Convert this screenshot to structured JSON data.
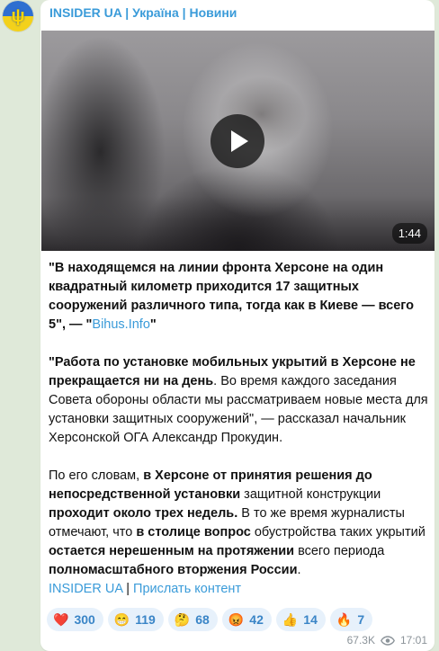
{
  "channel": {
    "name": "INSIDER UA | Україна | Новини",
    "avatar_icon": "trident-icon"
  },
  "video": {
    "duration": "1:44"
  },
  "message": {
    "p1_a": "\"В находящемся на линии фронта Херсоне на один квадратный километр приходится 17 защитных сооружений различного типа, тогда как в Киеве — всего 5\", — \"",
    "p1_link": "Bihus.Info",
    "p1_b": "\"",
    "p2_bold": "\"Работа по установке мобильных укрытий в Херсоне не прекращается ни на день",
    "p2_rest": ". Во время каждого заседания Совета обороны области мы рассматриваем новые места для установки защитных сооружений\", — рассказал начальник Херсонской ОГА Александр Прокудин.",
    "p3_1": "По его словам, ",
    "p3_2": "в Херсоне от принятия решения до непосредственной установки",
    "p3_3": " защитной конструкции ",
    "p3_4": "проходит около трех недель.",
    "p3_5": " В то же время журналисты отмечают, что ",
    "p3_6": "в столице вопрос",
    "p3_7": " обустройства таких укрытий ",
    "p3_8": "остается нерешенным на протяжении",
    "p3_9": " всего периода ",
    "p3_10": "полномасштабного вторжения России",
    "p3_11": "."
  },
  "footer": {
    "link1": "INSIDER UA",
    "separator": " | ",
    "link2": "Прислать контент"
  },
  "reactions": [
    {
      "emoji": "❤️",
      "count": "300"
    },
    {
      "emoji": "😁",
      "count": "119"
    },
    {
      "emoji": "🤔",
      "count": "68"
    },
    {
      "emoji": "😡",
      "count": "42"
    },
    {
      "emoji": "👍",
      "count": "14"
    },
    {
      "emoji": "🔥",
      "count": "7"
    }
  ],
  "meta": {
    "views": "67.3K",
    "time": "17:01",
    "views_icon": "eye-icon"
  },
  "colors": {
    "accent": "#3a9bd9",
    "chat_bg": "#dfe9d9",
    "reaction_bg": "#e7f1fb"
  }
}
